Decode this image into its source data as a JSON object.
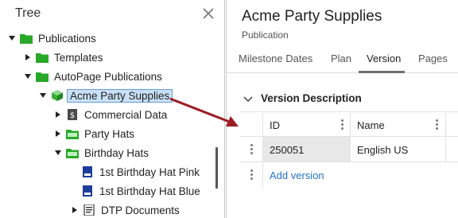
{
  "tree": {
    "title": "Tree",
    "nodes": [
      {
        "label": "Publications",
        "toggle": "expanded",
        "icon": "folder-icon"
      },
      {
        "label": "Templates",
        "toggle": "collapsed",
        "icon": "folder-icon"
      },
      {
        "label": "AutoPage Publications",
        "toggle": "expanded",
        "icon": "folder-icon"
      },
      {
        "label": "Acme Party Supplies",
        "toggle": "expanded",
        "icon": "publication-cube-icon",
        "selected": true
      },
      {
        "label": "Commercial Data",
        "toggle": "collapsed",
        "icon": "commercial-data-icon"
      },
      {
        "label": "Party Hats",
        "toggle": "collapsed",
        "icon": "folder-open-icon"
      },
      {
        "label": "Birthday Hats",
        "toggle": "expanded",
        "icon": "folder-open-icon"
      },
      {
        "label": "1st Birthday Hat Pink",
        "toggle": "none",
        "icon": "document-icon"
      },
      {
        "label": "1st Birthday Hat Blue",
        "toggle": "none",
        "icon": "document-icon"
      },
      {
        "label": "DTP Documents",
        "toggle": "collapsed",
        "icon": "dtp-document-icon"
      }
    ]
  },
  "detail": {
    "title": "Acme Party Supplies",
    "subtitle": "Publication",
    "tabs": [
      {
        "label": "Milestone Dates"
      },
      {
        "label": "Plan"
      },
      {
        "label": "Version"
      },
      {
        "label": "Pages"
      }
    ],
    "active_tab": "Version",
    "section": {
      "title": "Version Description",
      "columns": [
        "ID",
        "Name"
      ],
      "rows": [
        [
          "250051",
          "English US"
        ]
      ],
      "add_label": "Add version"
    }
  },
  "colors": {
    "folder_green": "#29a829",
    "selection_bg": "#c9e1f7",
    "selection_border": "#6a9fd0",
    "arrow_red": "#9b1c25",
    "link_blue": "#2a72c8",
    "document_blue": "#1d3d9a"
  }
}
